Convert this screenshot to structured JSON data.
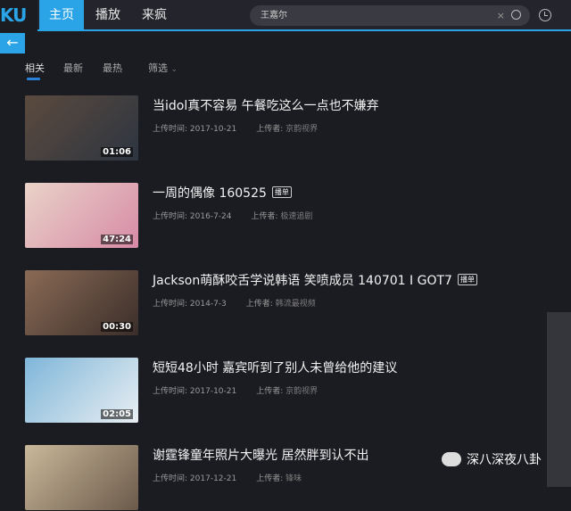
{
  "header": {
    "logo": "KU",
    "nav": [
      "主页",
      "播放",
      "来疯"
    ],
    "search_value": "王嘉尔",
    "clear": "×"
  },
  "filters": {
    "tabs": [
      "相关",
      "最新",
      "最热",
      "筛选"
    ],
    "dropdown": "⌄"
  },
  "back": "←",
  "meta_labels": {
    "time": "上传时间:",
    "uploader": "上传者:"
  },
  "videos": [
    {
      "title": "当idol真不容易 午餐吃这么一点也不嫌弃",
      "tag": "",
      "duration": "01:06",
      "date": "2017-10-21",
      "uploader": "京韵视界",
      "colors": [
        "#5b4a3e",
        "#2d3540"
      ]
    },
    {
      "title": "一周的偶像 160525",
      "tag": "播单",
      "duration": "47:24",
      "date": "2016-7-24",
      "uploader": "极速追剧",
      "colors": [
        "#e9d3c8",
        "#d78aa6"
      ]
    },
    {
      "title": "Jackson萌酥咬舌学说韩语 笑喷成员 140701 I GOT7",
      "tag": "播单",
      "duration": "00:30",
      "date": "2014-7-3",
      "uploader": "韩流最视频",
      "colors": [
        "#8a6a55",
        "#3a2e2a"
      ]
    },
    {
      "title": "短短48小时 嘉宾听到了别人未曾给他的建议",
      "tag": "",
      "duration": "02:05",
      "date": "2017-10-21",
      "uploader": "京韵视界",
      "colors": [
        "#7fb6d9",
        "#e8eef2"
      ]
    },
    {
      "title": "谢霆锋童年照片大曝光 居然胖到认不出",
      "tag": "",
      "duration": "",
      "date": "2017-12-21",
      "uploader": "锋味",
      "colors": [
        "#c9b89a",
        "#6b5a4a"
      ]
    }
  ],
  "watermark": "深八深夜八卦"
}
